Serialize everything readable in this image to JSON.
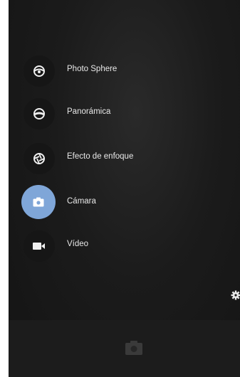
{
  "modes": [
    {
      "label": "Photo Sphere",
      "icon": "photo-sphere-icon",
      "active": false
    },
    {
      "label": "Panorámica",
      "icon": "panorama-icon",
      "active": false
    },
    {
      "label": "Efecto de enfoque",
      "icon": "lens-blur-icon",
      "active": false
    },
    {
      "label": "Cámara",
      "icon": "camera-icon",
      "active": true
    },
    {
      "label": "Vídeo",
      "icon": "video-icon",
      "active": false
    }
  ],
  "colors": {
    "active_mode_bg": "#7fa6d8",
    "inactive_mode_bg": "#161616",
    "label_text": "#e8e8e8"
  }
}
